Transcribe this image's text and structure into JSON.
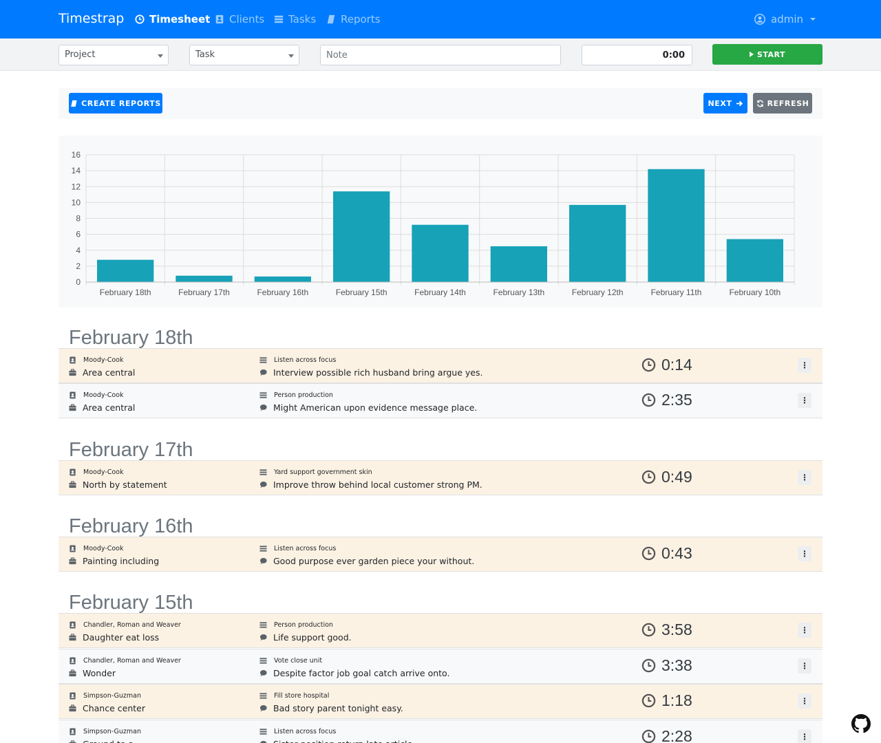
{
  "navbar": {
    "brand": "Timestrap",
    "items": [
      {
        "label": "Timesheet",
        "active": true
      },
      {
        "label": "Clients",
        "active": false
      },
      {
        "label": "Tasks",
        "active": false
      },
      {
        "label": "Reports",
        "active": false
      }
    ],
    "user": "admin"
  },
  "entry_bar": {
    "project_placeholder": "Project",
    "task_placeholder": "Task",
    "note_placeholder": "Note",
    "timer_value": "0:00",
    "start_label": "START"
  },
  "toolbar": {
    "create_reports_label": "CREATE REPORTS",
    "next_label": "NEXT",
    "refresh_label": "REFRESH"
  },
  "colors": {
    "primary": "#007bff",
    "success": "#28a745",
    "secondary": "#6c757d",
    "bar": "#17a2b8",
    "row_highlight": "#fcf2e4"
  },
  "chart_data": {
    "type": "bar",
    "categories": [
      "February 18th",
      "February 17th",
      "February 16th",
      "February 15th",
      "February 14th",
      "February 13th",
      "February 12th",
      "February 11th",
      "February 10th"
    ],
    "values": [
      2.8,
      0.8,
      0.7,
      11.4,
      7.2,
      4.5,
      9.7,
      14.2,
      5.4
    ],
    "ylim": [
      0,
      16
    ],
    "yticks": [
      0,
      2,
      4,
      6,
      8,
      10,
      12,
      14,
      16
    ],
    "grid": true,
    "title": "",
    "xlabel": "",
    "ylabel": ""
  },
  "groups": [
    {
      "date": "February 18th",
      "entries": [
        {
          "client": "Moody-Cook",
          "project": "Area central",
          "task": "Listen across focus",
          "note": "Interview possible rich husband bring argue yes.",
          "duration": "0:14"
        },
        {
          "client": "Moody-Cook",
          "project": "Area central",
          "task": "Person production",
          "note": "Might American upon evidence message place.",
          "duration": "2:35"
        }
      ]
    },
    {
      "date": "February 17th",
      "entries": [
        {
          "client": "Moody-Cook",
          "project": "North by statement",
          "task": "Yard support government skin",
          "note": "Improve throw behind local customer strong PM.",
          "duration": "0:49"
        }
      ]
    },
    {
      "date": "February 16th",
      "entries": [
        {
          "client": "Moody-Cook",
          "project": "Painting including",
          "task": "Listen across focus",
          "note": "Good purpose ever garden piece your without.",
          "duration": "0:43"
        }
      ]
    },
    {
      "date": "February 15th",
      "entries": [
        {
          "client": "Chandler, Roman and Weaver",
          "project": "Daughter eat loss",
          "task": "Person production",
          "note": "Life support good.",
          "duration": "3:58"
        },
        {
          "client": "Chandler, Roman and Weaver",
          "project": "Wonder",
          "task": "Vote close unit",
          "note": "Despite factor job goal catch arrive onto.",
          "duration": "3:38"
        },
        {
          "client": "Simpson-Guzman",
          "project": "Chance center",
          "task": "Fill store hospital",
          "note": "Bad story parent tonight easy.",
          "duration": "1:18"
        },
        {
          "client": "Simpson-Guzman",
          "project": "Ground to a",
          "task": "Listen across focus",
          "note": "Sister position return late article.",
          "duration": "2:28"
        }
      ]
    }
  ]
}
